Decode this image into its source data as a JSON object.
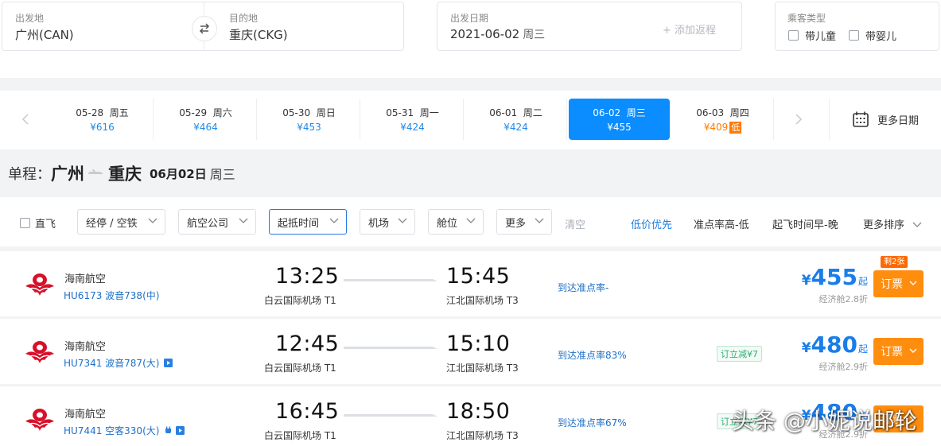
{
  "search": {
    "from_label": "出发地",
    "from_value": "广州(CAN)",
    "to_label": "目的地",
    "to_value": "重庆(CKG)",
    "date_label": "出发日期",
    "date_value": "2021-06-02",
    "date_weekday": "周三",
    "add_return": "+ 添加返程",
    "pax_label": "乘客类型",
    "pax_child": "带儿童",
    "pax_infant": "带婴儿"
  },
  "date_strip": {
    "items": [
      {
        "date": "05-28  周五",
        "price": "¥616"
      },
      {
        "date": "05-29  周六",
        "price": "¥464"
      },
      {
        "date": "05-30  周日",
        "price": "¥453"
      },
      {
        "date": "05-31  周一",
        "price": "¥424"
      },
      {
        "date": "06-01  周二",
        "price": "¥424"
      },
      {
        "date": "06-02  周三",
        "price": "¥455"
      },
      {
        "date": "06-03  周四",
        "price": "¥409",
        "badge": "低"
      }
    ],
    "active_index": 5,
    "more_dates": "更多日期"
  },
  "trip": {
    "type": "单程：",
    "from_city": "广州",
    "to_city": "重庆",
    "date": "06月02日",
    "weekday": "周三"
  },
  "filters": {
    "direct": "直飞",
    "stopover": "经停 / 空铁",
    "airline": "航空公司",
    "time": "起抵时间",
    "airport": "机场",
    "cabin": "舱位",
    "more": "更多",
    "clear": "清空",
    "sort_low_price": "低价优先",
    "sort_ontime": "准点率高-低",
    "sort_departure": "起飞时间早-晚",
    "sort_more": "更多排序"
  },
  "flights": [
    {
      "airline": "海南航空",
      "flight": "HU6173 波音738(中)",
      "dep_time": "13:25",
      "dep_airport": "白云国际机场 T1",
      "arr_time": "15:45",
      "arr_airport": "江北国际机场 T3",
      "ontime": "到达准点率-",
      "tag": "",
      "price_symbol": "¥",
      "price": "455",
      "price_suffix": "起",
      "cabin": "经济舱2.8折",
      "remaining": "剩2张",
      "book": "订票"
    },
    {
      "airline": "海南航空",
      "flight": "HU7341 波音787(大)",
      "dep_time": "12:45",
      "dep_airport": "白云国际机场 T1",
      "arr_time": "15:10",
      "arr_airport": "江北国际机场 T3",
      "ontime": "到达准点率83%",
      "tag": "订立减¥7",
      "price_symbol": "¥",
      "price": "480",
      "price_suffix": "起",
      "cabin": "经济舱2.9折",
      "book": "订票"
    },
    {
      "airline": "海南航空",
      "flight": "HU7441 空客330(大)",
      "dep_time": "16:45",
      "dep_airport": "白云国际机场 T1",
      "arr_time": "18:50",
      "arr_airport": "江北国际机场 T3",
      "ontime": "到达准点率67%",
      "tag": "订立减¥7",
      "price_symbol": "¥",
      "price": "480",
      "price_suffix": "起",
      "cabin": "经济舱2.9折",
      "book": "订票"
    }
  ],
  "watermark": "头条 @小妮说邮轮",
  "colors": {
    "accent": "#0b8cff",
    "price": "#1a7dea",
    "book_button": "#ff8d0e",
    "cheap": "#ff7b00",
    "airline_logo": "#d8102a"
  }
}
